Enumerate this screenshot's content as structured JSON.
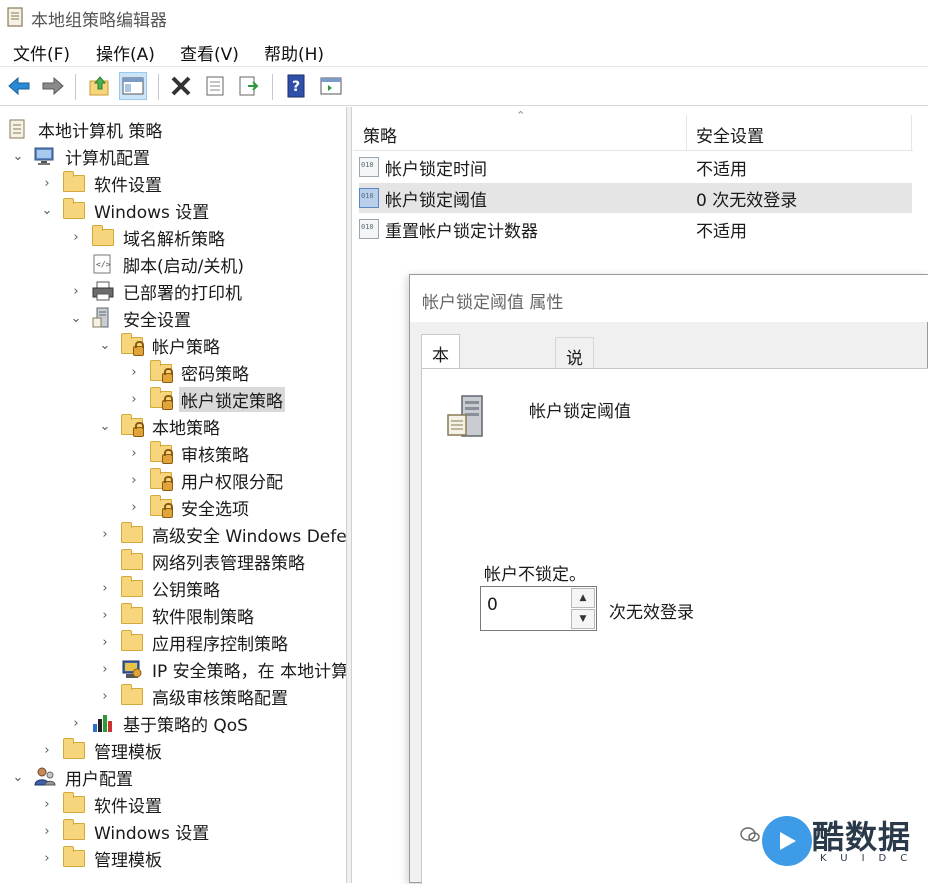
{
  "window": {
    "title": "本地组策略编辑器"
  },
  "menu": [
    "文件(F)",
    "操作(A)",
    "查看(V)",
    "帮助(H)"
  ],
  "toolbar": {
    "buttons": [
      "back-arrow-icon",
      "forward-arrow-icon",
      "up-folder-icon",
      "show-hide-tree-icon",
      "delete-icon",
      "properties-icon",
      "export-list-icon",
      "help-icon",
      "action-pane-icon"
    ]
  },
  "tree": {
    "root": "本地计算机 策略",
    "computer_config": "计算机配置",
    "software_settings": "软件设置",
    "windows_settings": "Windows 设置",
    "name_resolution": "域名解析策略",
    "scripts": "脚本(启动/关机)",
    "printers": "已部署的打印机",
    "security_settings": "安全设置",
    "account_policies": "帐户策略",
    "password_policy": "密码策略",
    "lockout_policy": "帐户锁定策略",
    "local_policies": "本地策略",
    "audit_policy": "审核策略",
    "user_rights": "用户权限分配",
    "security_options": "安全选项",
    "defender_firewall": "高级安全 Windows Defe",
    "network_list": "网络列表管理器策略",
    "public_key": "公钥策略",
    "software_restriction": "软件限制策略",
    "app_control": "应用程序控制策略",
    "ip_security": "IP 安全策略，在 本地计算",
    "advanced_audit": "高级审核策略配置",
    "qos": "基于策略的 QoS",
    "admin_templates": "管理模板",
    "user_config": "用户配置",
    "user_software_settings": "软件设置",
    "user_windows_settings": "Windows 设置",
    "user_admin_templates": "管理模板"
  },
  "list": {
    "columns": [
      "策略",
      "安全设置"
    ],
    "rows": [
      {
        "policy": "帐户锁定时间",
        "setting": "不适用"
      },
      {
        "policy": "帐户锁定阈值",
        "setting": "0 次无效登录"
      },
      {
        "policy": "重置帐户锁定计数器",
        "setting": "不适用"
      }
    ]
  },
  "dialog": {
    "title": "帐户锁定阈值 属性",
    "tabs": [
      "本地安全设置",
      "说明"
    ],
    "policy_name": "帐户锁定阈值",
    "status": "帐户不锁定。",
    "value": "0",
    "unit": "次无效登录"
  },
  "watermark": {
    "text": "酷数据",
    "sub": "KUIDC"
  },
  "colors": {
    "selection": "#d9d9d9",
    "folder": "#f6d57d",
    "accent": "#3e9be8"
  }
}
